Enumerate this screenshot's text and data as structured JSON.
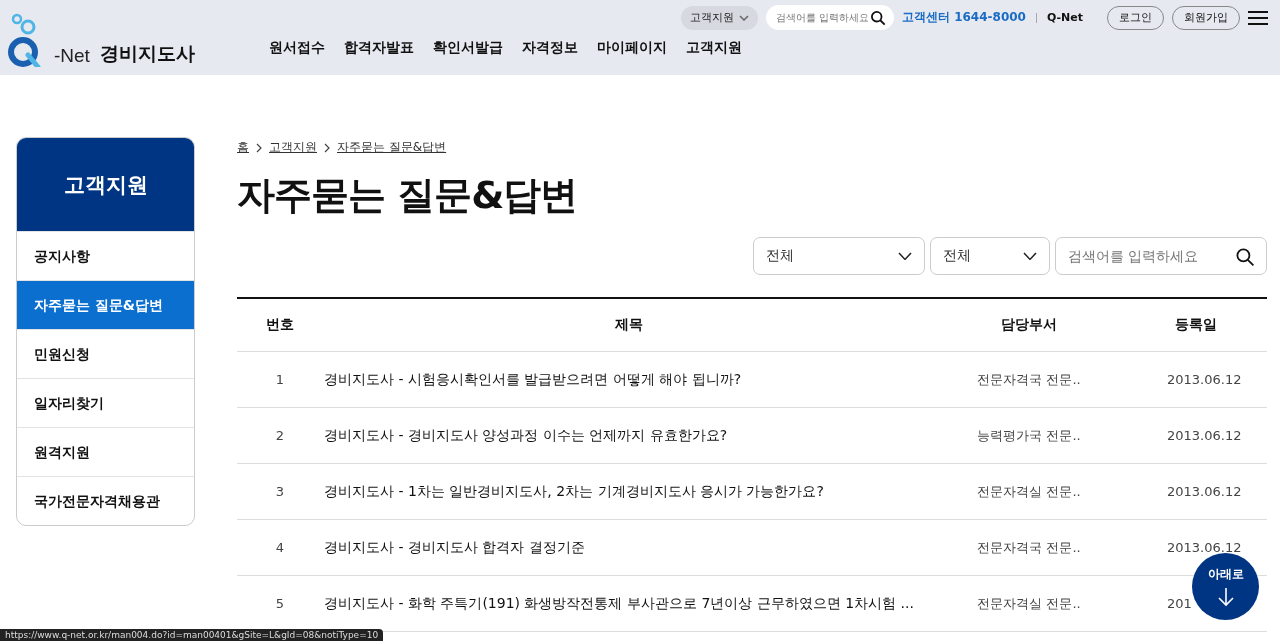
{
  "header": {
    "site_name": "경비지도사",
    "logo_text": "-Net",
    "utility": {
      "dropdown": "고객지원",
      "search": {
        "placeholder": "검색어를 입력하세요"
      },
      "phone": "고객센터 1644-8000",
      "site_link": "Q-Net",
      "buttons": [
        "로그인",
        "회원가입"
      ]
    },
    "nav": [
      "원서접수",
      "합격자발표",
      "확인서발급",
      "자격정보",
      "마이페이지",
      "고객지원"
    ]
  },
  "sidebar": {
    "title": "고객지원",
    "items": [
      {
        "label": "공지사항",
        "selected": false
      },
      {
        "label": "자주묻는 질문&답변",
        "selected": true
      },
      {
        "label": "민원신청",
        "selected": false
      },
      {
        "label": "일자리찾기",
        "selected": false
      },
      {
        "label": "원격지원",
        "selected": false
      },
      {
        "label": "국가전문자격채용관",
        "selected": false
      }
    ]
  },
  "breadcrumb": [
    "홈",
    "고객지원",
    "자주묻는 질문&답변"
  ],
  "page_title": "자주묻는 질문&답변",
  "filters": {
    "selects": [
      "전체",
      "전체"
    ],
    "search": {
      "placeholder": "검색어를 입력하세요"
    }
  },
  "table": {
    "columns": [
      "번호",
      "제목",
      "담당부서",
      "등록일"
    ],
    "rows": [
      [
        "1",
        "경비지도사 - 시험응시확인서를 발급받으려면 어떻게 해야 됩니까?",
        "전문자격국 전문..",
        "2013.06.12"
      ],
      [
        "2",
        "경비지도사 - 경비지도사 양성과정 이수는 언제까지 유효한가요?",
        "능력평가국 전문..",
        "2013.06.12"
      ],
      [
        "3",
        "경비지도사 - 1차는 일반경비지도사, 2차는 기계경비지도사 응시가 가능한가요?",
        "전문자격실 전문..",
        "2013.06.12"
      ],
      [
        "4",
        "경비지도사 - 경비지도사 합격자 결정기준",
        "전문자격국 전문..",
        "2013.06.12"
      ],
      [
        "5",
        "경비지도사 - 화학 주특기(191) 화생방작전통제 부사관으로 7년이상 근무하였으면 1차시험 ...",
        "전문자격실 전문..",
        "201"
      ]
    ]
  },
  "scroll_button": "아래로",
  "status_bar": "https://www.q-net.or.kr/man004.do?id=man00401&gSite=L&gId=08&notiType=10"
}
